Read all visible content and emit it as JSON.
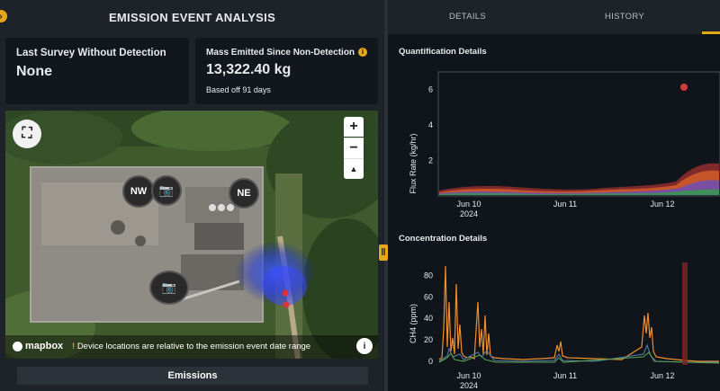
{
  "header": {
    "title": "EMISSION EVENT ANALYSIS"
  },
  "cards": {
    "last_survey": {
      "label": "Last Survey Without Detection",
      "value": "None"
    },
    "mass_emitted": {
      "label": "Mass Emitted Since Non-Detection",
      "value": "13,322.40 kg",
      "sub": "Based off 91 days",
      "info_icon": "info-icon"
    }
  },
  "map": {
    "markers": {
      "nw": "NW",
      "ne": "NE"
    },
    "zoom_in": "+",
    "zoom_out": "−",
    "compass": "▲",
    "attribution": "mapbox",
    "note": "Device locations are relative to the emission event date range",
    "info": "i"
  },
  "footer": {
    "emissions_button": "Emissions"
  },
  "tabs": [
    {
      "label": "DETAILS",
      "active": false
    },
    {
      "label": "HISTORY",
      "active": true
    }
  ],
  "quantification": {
    "title": "Quantification Details",
    "chart_data": {
      "type": "area",
      "ylabel": "Flux Rate (kg/hr)",
      "yticks": [
        "2",
        "4",
        "6"
      ],
      "xticks": [
        "Jun 10\n2024",
        "Jun 11",
        "Jun 12"
      ],
      "outlier_point": {
        "x": "Jun 12",
        "y": 6.3
      }
    }
  },
  "concentration": {
    "title": "Concentration Details",
    "chart_data": {
      "type": "line",
      "ylabel": "CH4 (ppm)",
      "yticks": [
        "0",
        "20",
        "40",
        "60",
        "80"
      ],
      "xticks": [
        "Jun 10\n2024",
        "Jun 11",
        "Jun 12"
      ],
      "series_colors": [
        "#f28e2b",
        "#4e79a7",
        "#59a14f"
      ]
    }
  },
  "colors": {
    "accent": "#e6a817",
    "background": "#10151b",
    "panel": "#1e2329"
  }
}
